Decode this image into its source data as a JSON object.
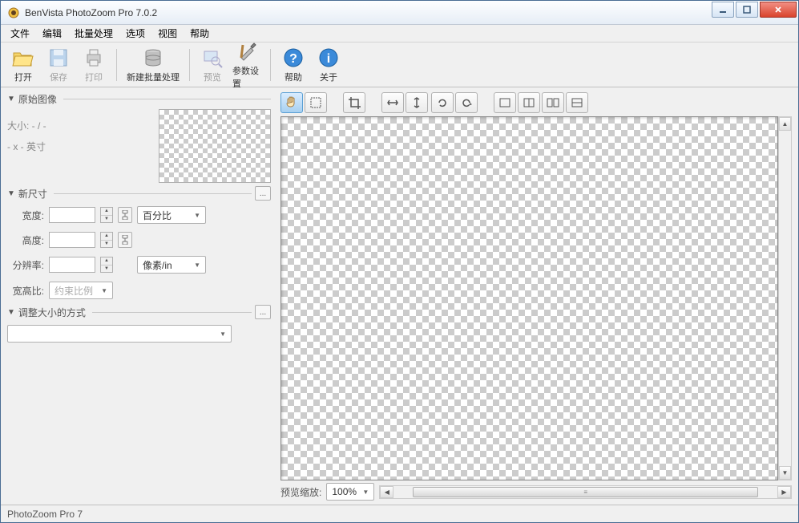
{
  "window": {
    "title": "BenVista PhotoZoom Pro 7.0.2"
  },
  "menu": {
    "items": [
      "文件",
      "编辑",
      "批量处理",
      "选项",
      "视图",
      "帮助"
    ]
  },
  "toolbar": {
    "open": "打开",
    "save": "保存",
    "print": "打印",
    "batch": "新建批量处理",
    "preview": "预览",
    "params": "参数设置",
    "help": "帮助",
    "about": "关于"
  },
  "sidebar": {
    "orig_section": "原始图像",
    "size_label": "大小: - / -",
    "unit_label": "- x - 英寸",
    "newsize_section": "新尺寸",
    "width_label": "宽度:",
    "height_label": "高度:",
    "res_label": "分辨率:",
    "aspect_label": "宽高比:",
    "unit_dd": "百分比",
    "res_unit_dd": "像素/in",
    "aspect_dd": "约束比例",
    "resize_section": "调整大小的方式",
    "ellipsis": "..."
  },
  "preview": {
    "zoom_label": "预览缩放:",
    "zoom_value": "100%"
  },
  "status": {
    "text": "PhotoZoom Pro 7"
  }
}
